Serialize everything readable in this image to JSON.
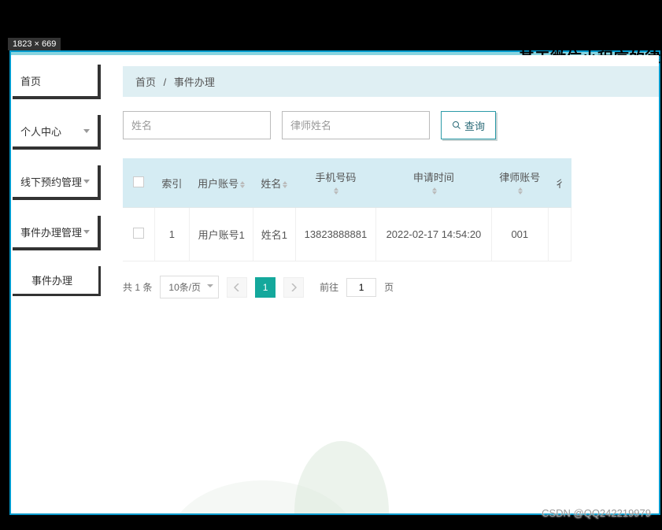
{
  "image_dim_label": "1823 × 669",
  "app_title": "基于微信小程序的律",
  "sidebar": {
    "items": [
      {
        "label": "首页",
        "expandable": false
      },
      {
        "label": "个人中心",
        "expandable": true
      },
      {
        "label": "线下预约管理",
        "expandable": true
      },
      {
        "label": "事件办理管理",
        "expandable": true
      }
    ],
    "sub_item": {
      "label": "事件办理"
    }
  },
  "breadcrumb": {
    "home": "首页",
    "sep": "/",
    "current": "事件办理"
  },
  "search": {
    "name_placeholder": "姓名",
    "lawyer_placeholder": "律师姓名",
    "query_label": "查询"
  },
  "table": {
    "headers": {
      "index": "索引",
      "user_account": "用户账号",
      "name": "姓名",
      "phone": "手机号码",
      "apply_time": "申请时间",
      "lawyer_account": "律师账号",
      "more": "彳"
    },
    "rows": [
      {
        "index": "1",
        "user_account": "用户账号1",
        "name": "姓名1",
        "phone": "13823888881",
        "apply_time": "2022-02-17 14:54:20",
        "lawyer_account": "001"
      }
    ]
  },
  "pagination": {
    "total_prefix": "共",
    "total_count": "1",
    "total_suffix": "条",
    "page_size": "10条/页",
    "current": "1",
    "goto_prefix": "前往",
    "goto_value": "1",
    "goto_suffix": "页"
  },
  "watermark": "CSDN @QQ242219979"
}
